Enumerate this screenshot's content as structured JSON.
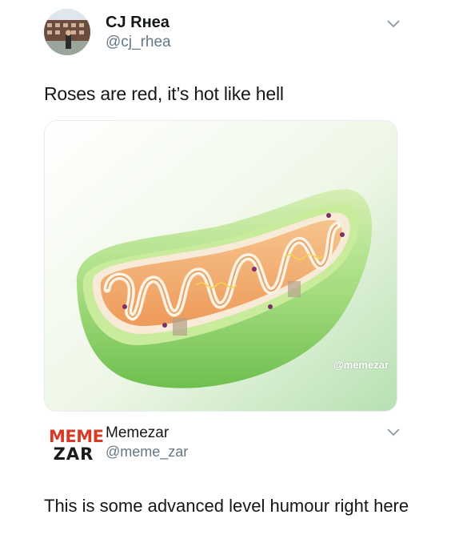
{
  "tweet1": {
    "author_name": "CJ Rнea",
    "author_handle": "@cj_rhea",
    "text": "Roses are red, it’s hot like hell",
    "media": {
      "description_icon": "mitochondria-illustration",
      "watermark": "@memezar"
    },
    "menu_icon": "chevron-down-icon"
  },
  "tweet2": {
    "logo_line1": "MEME",
    "logo_line2": "ZAR",
    "author_name": "Memezar",
    "author_handle": "@meme_zar",
    "text": "This is some advanced level humour right here",
    "menu_icon": "chevron-down-icon"
  },
  "colors": {
    "handle_gray": "#657786",
    "text_dark": "#14171a",
    "logo_red": "#d83b25",
    "organelle_green": "#8fcf6a",
    "matrix_orange": "#f0a868"
  }
}
